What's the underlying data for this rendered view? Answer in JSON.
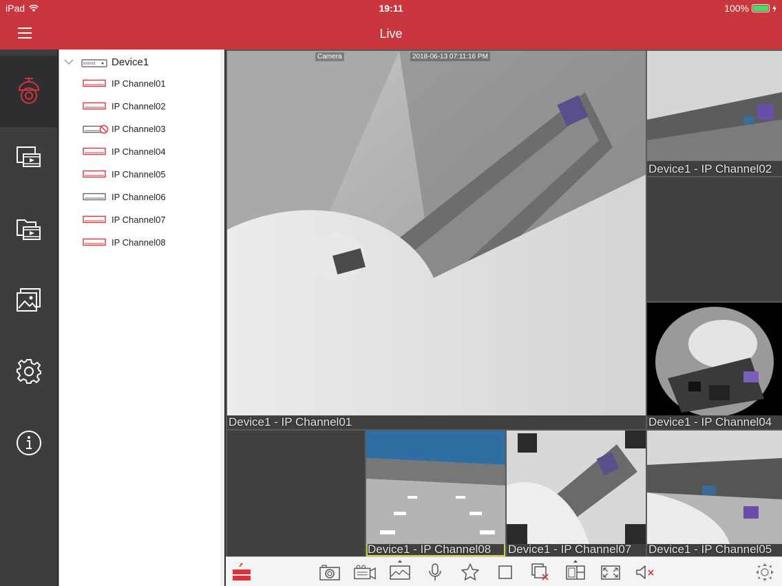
{
  "status": {
    "device": "iPad",
    "time": "19:11",
    "battery": "100%"
  },
  "header": {
    "title": "Live"
  },
  "colors": {
    "accent": "#c9363d",
    "rail": "#3d3d3f",
    "selected_tile": "#d4d43a"
  },
  "nav": {
    "items": [
      {
        "icon": "camera-icon",
        "active": true
      },
      {
        "icon": "playback-icon"
      },
      {
        "icon": "local-files-icon"
      },
      {
        "icon": "pictures-icon"
      },
      {
        "icon": "settings-icon"
      },
      {
        "icon": "info-icon"
      }
    ]
  },
  "tree": {
    "device": "Device1",
    "channels": [
      {
        "label": "IP Channel01",
        "status": "online"
      },
      {
        "label": "IP Channel02",
        "status": "online"
      },
      {
        "label": "IP Channel03",
        "status": "disabled"
      },
      {
        "label": "IP Channel04",
        "status": "online"
      },
      {
        "label": "IP Channel05",
        "status": "online"
      },
      {
        "label": "IP Channel06",
        "status": "offline"
      },
      {
        "label": "IP Channel07",
        "status": "online"
      },
      {
        "label": "IP Channel08",
        "status": "online"
      }
    ]
  },
  "tiles": {
    "main": {
      "label": "Device1 - IP Channel01",
      "osd_name": "Camera",
      "osd_time": "2018-06-13 07:11:16 PM"
    },
    "ch02": {
      "label": "Device1 - IP Channel02"
    },
    "ch04": {
      "label": "Device1 - IP Channel04"
    },
    "ch08": {
      "label": "Device1 - IP Channel08"
    },
    "ch07": {
      "label": "Device1 - IP Channel07"
    },
    "ch05": {
      "label": "Device1 - IP Channel05"
    }
  },
  "toolbar": {
    "buttons": [
      "stream-icon",
      "capture-icon",
      "record-icon",
      "quality-icon",
      "talk-icon",
      "favorite-icon",
      "stop-all-icon",
      "delete-window-icon",
      "layout-icon",
      "fullscreen-icon",
      "mute-icon",
      "ptz-icon"
    ]
  }
}
